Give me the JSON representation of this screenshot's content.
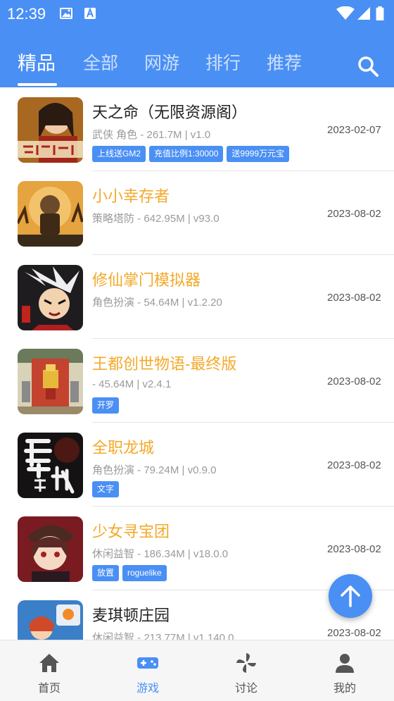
{
  "status_bar": {
    "time": "12:39"
  },
  "tabs": [
    {
      "label": "精品",
      "active": true
    },
    {
      "label": "全部"
    },
    {
      "label": "网游"
    },
    {
      "label": "排行"
    },
    {
      "label": "推荐"
    }
  ],
  "colors": {
    "primary": "#4a8ff4",
    "title_orange": "#f3a92a",
    "title_dark": "#222222",
    "meta_gray": "#9a9a9a"
  },
  "games": [
    {
      "title": "天之命（无限资源阁）",
      "meta": "武侠 角色 - 261.7M | v1.0",
      "date": "2023-02-07",
      "tags": [
        "上线送GM2",
        "充值比例1:30000",
        "送9999万元宝"
      ],
      "title_color": "#222222"
    },
    {
      "title": "小小幸存者",
      "meta": "策略塔防 - 642.95M | v93.0",
      "date": "2023-08-02",
      "tags": [],
      "title_color": "#f3a92a"
    },
    {
      "title": "修仙掌门模拟器",
      "meta": "角色扮演 - 54.64M | v1.2.20",
      "date": "2023-08-02",
      "tags": [],
      "title_color": "#f3a92a"
    },
    {
      "title": "王都创世物语-最终版",
      "meta": " - 45.64M | v2.4.1",
      "date": "2023-08-02",
      "tags": [
        "开罗"
      ],
      "title_color": "#f3a92a"
    },
    {
      "title": "全职龙城",
      "meta": "角色扮演 - 79.24M | v0.9.0",
      "date": "2023-08-02",
      "tags": [
        "文字"
      ],
      "title_color": "#f3a92a"
    },
    {
      "title": "少女寻宝团",
      "meta": "休闲益智 - 186.34M | v18.0.0",
      "date": "2023-08-02",
      "tags": [
        "放置",
        "roguelike"
      ],
      "title_color": "#f3a92a"
    },
    {
      "title": "麦琪顿庄园",
      "meta": "休闲益智 - 213.77M | v1.140.0",
      "date": "2023-08-02",
      "tags": [],
      "title_color": "#222222"
    }
  ],
  "bottom_nav": [
    {
      "label": "首页",
      "icon": "home-icon"
    },
    {
      "label": "游戏",
      "icon": "gamepad-icon",
      "active": true
    },
    {
      "label": "讨论",
      "icon": "pinwheel-icon"
    },
    {
      "label": "我的",
      "icon": "user-icon"
    }
  ]
}
